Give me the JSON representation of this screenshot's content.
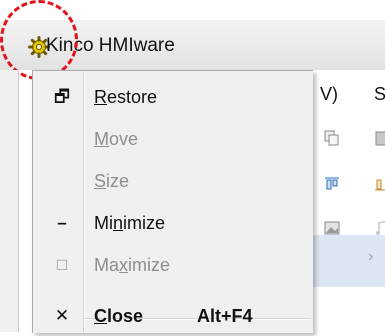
{
  "window": {
    "title": "Kinco HMIware",
    "icon": "gear-icon",
    "highlight_color": "#e0141e"
  },
  "background_app": {
    "menu_peek": [
      "V)",
      "S"
    ],
    "selected_row_color": "#dde6f3",
    "arrow_glyph": "›"
  },
  "system_menu": {
    "items": [
      {
        "pre": "",
        "mnemonic": "R",
        "post": "estore",
        "icon": "restore-icon",
        "glyph": "🗗",
        "disabled": false
      },
      {
        "pre": "",
        "mnemonic": "M",
        "post": "ove",
        "icon": "",
        "glyph": "",
        "disabled": true
      },
      {
        "pre": "",
        "mnemonic": "S",
        "post": "ize",
        "icon": "",
        "glyph": "",
        "disabled": true
      },
      {
        "pre": "Mi",
        "mnemonic": "n",
        "post": "imize",
        "icon": "minimize-icon",
        "glyph": "–",
        "disabled": false
      },
      {
        "pre": "Ma",
        "mnemonic": "x",
        "post": "imize",
        "icon": "maximize-icon",
        "glyph": "□",
        "disabled": true
      },
      {
        "pre": "",
        "mnemonic": "C",
        "post": "lose",
        "icon": "close-icon",
        "glyph": "✕",
        "disabled": false,
        "bold": true,
        "shortcut": "Alt+F4"
      }
    ]
  }
}
